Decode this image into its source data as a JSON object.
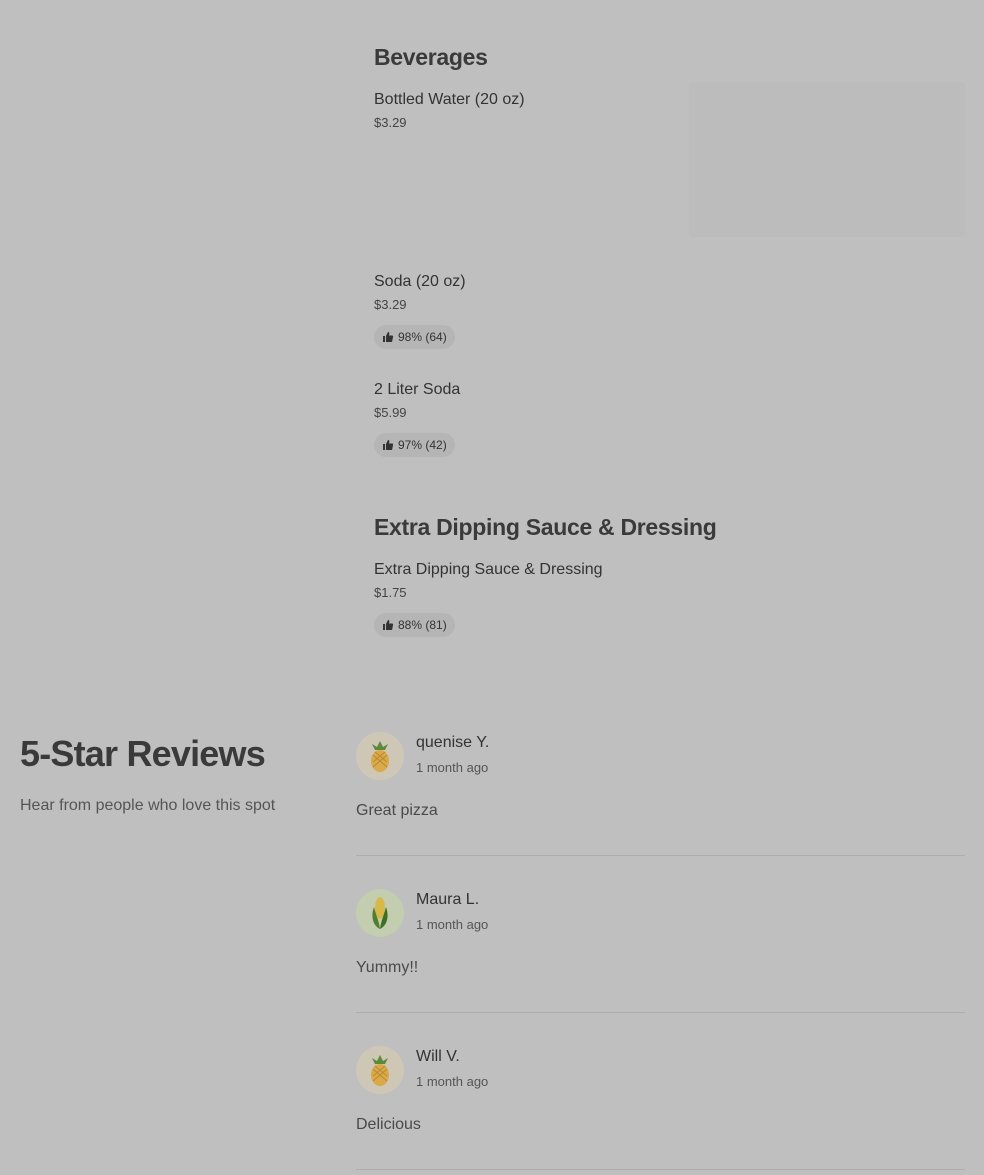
{
  "menu": {
    "beverages": {
      "title": "Beverages",
      "items": [
        {
          "name": "Bottled Water (20 oz)",
          "price": "$3.29"
        },
        {
          "name": "Soda (20 oz)",
          "price": "$3.29",
          "rating": "98% (64)"
        },
        {
          "name": "2 Liter Soda",
          "price": "$5.99",
          "rating": "97% (42)"
        }
      ]
    },
    "dipping": {
      "title": "Extra Dipping Sauce & Dressing",
      "items": [
        {
          "name": "Extra Dipping Sauce & Dressing",
          "price": "$1.75",
          "rating": "88% (81)"
        }
      ]
    }
  },
  "reviews": {
    "title": "5-Star Reviews",
    "subtitle": "Hear from people who love this spot",
    "items": [
      {
        "name": "quenise Y.",
        "time": "1 month ago",
        "text": "Great pizza",
        "avatar_icon": "pineapple-icon"
      },
      {
        "name": "Maura L.",
        "time": "1 month ago",
        "text": "Yummy!!",
        "avatar_icon": "corn-icon"
      },
      {
        "name": "Will V.",
        "time": "1 month ago",
        "text": "Delicious",
        "avatar_icon": "pineapple-icon"
      }
    ]
  },
  "icons": {
    "rating": "thumbs-up-icon"
  }
}
